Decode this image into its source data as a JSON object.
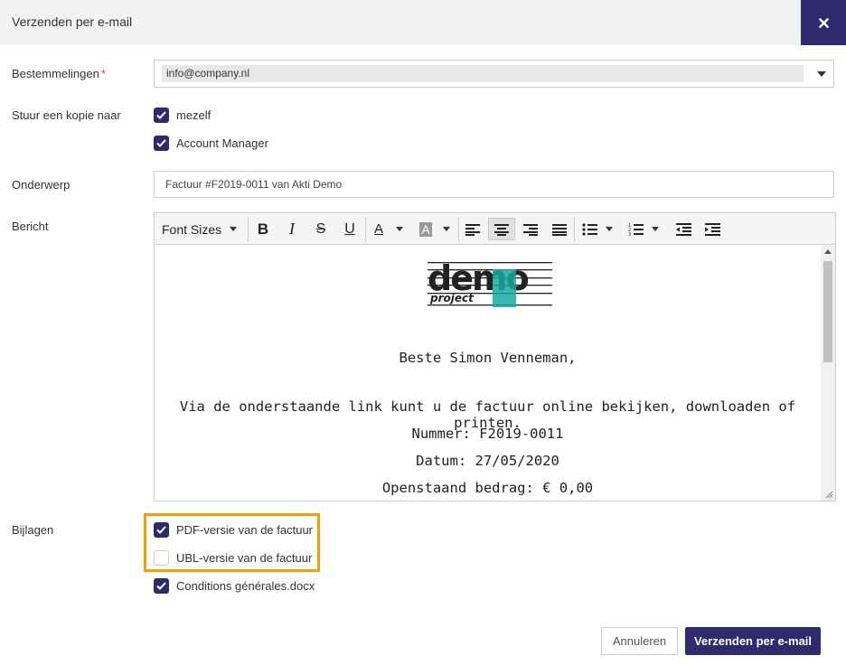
{
  "header": {
    "title": "Verzenden per e-mail",
    "close_icon": "close-icon"
  },
  "recipients": {
    "label": "Bestemmelingen",
    "required_mark": "*",
    "value": "info@company.nl"
  },
  "copy": {
    "label": "Stuur een kopie naar",
    "options": [
      {
        "label": "mezelf",
        "checked": true
      },
      {
        "label": "Account Manager",
        "checked": true
      }
    ]
  },
  "subject": {
    "label": "Onderwerp",
    "value": "Factuur #F2019-0011 van Akti Demo"
  },
  "message": {
    "label": "Bericht",
    "toolbar": {
      "font_sizes": "Font Sizes",
      "bold": "B",
      "italic": "I",
      "strike": "S",
      "underline": "U",
      "font_color": "A",
      "bg_color": "A"
    },
    "logo": {
      "top": "demo",
      "bottom": "project"
    },
    "greeting": "Beste  Simon Venneman,",
    "intro": "Via de onderstaande link kunt u de factuur online bekijken, downloaden of printen.",
    "number": "Nummer: F2019-0011",
    "date": "Datum: 27/05/2020",
    "outstanding": "Openstaand bedrag: € 0,00"
  },
  "attachments": {
    "label": "Bijlagen",
    "items": [
      {
        "label": "PDF-versie van de factuur",
        "checked": true
      },
      {
        "label": "UBL-versie van de factuur",
        "checked": false
      },
      {
        "label": "Conditions générales.docx",
        "checked": true
      }
    ]
  },
  "footer": {
    "cancel": "Annuleren",
    "send": "Verzenden per e-mail"
  },
  "colors": {
    "accent": "#2e2a6b",
    "highlight": "#f0a000",
    "logo_teal": "#17a99e"
  }
}
